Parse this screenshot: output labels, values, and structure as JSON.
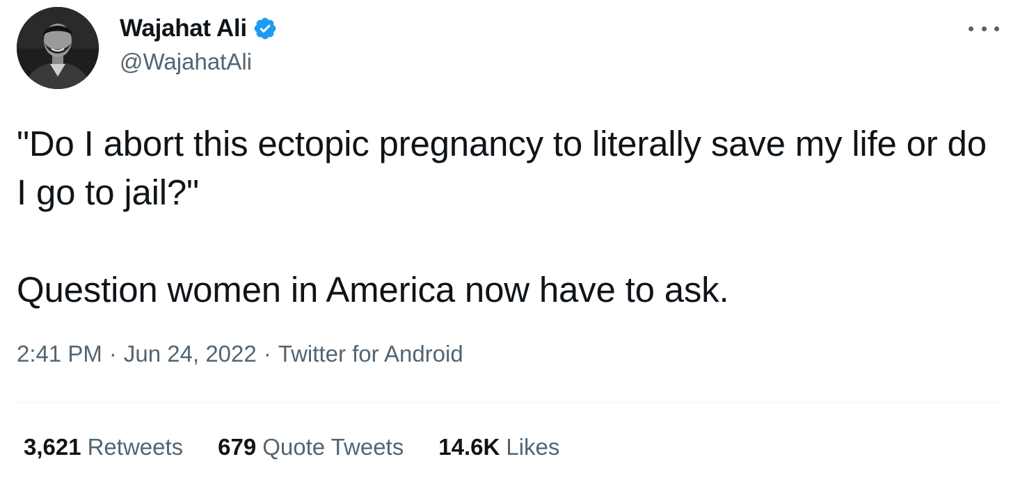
{
  "author": {
    "display_name": "Wajahat Ali",
    "handle": "@WajahatAli",
    "verified_icon": "verified-badge-icon",
    "verified_color": "#1d9bf0"
  },
  "tweet": {
    "line1": "\"Do I abort this ectopic pregnancy to literally save my life or do I go to jail?\"",
    "line2": "Question women in America now have to ask."
  },
  "meta": {
    "time": "2:41 PM",
    "separator": "·",
    "date": "Jun 24, 2022",
    "source": "Twitter for Android"
  },
  "stats": [
    {
      "count": "3,621",
      "label": "Retweets"
    },
    {
      "count": "679",
      "label": "Quote Tweets"
    },
    {
      "count": "14.6K",
      "label": "Likes"
    }
  ],
  "colors": {
    "text_primary": "#0f1419",
    "text_secondary": "#536471",
    "divider": "#eff3f4"
  }
}
